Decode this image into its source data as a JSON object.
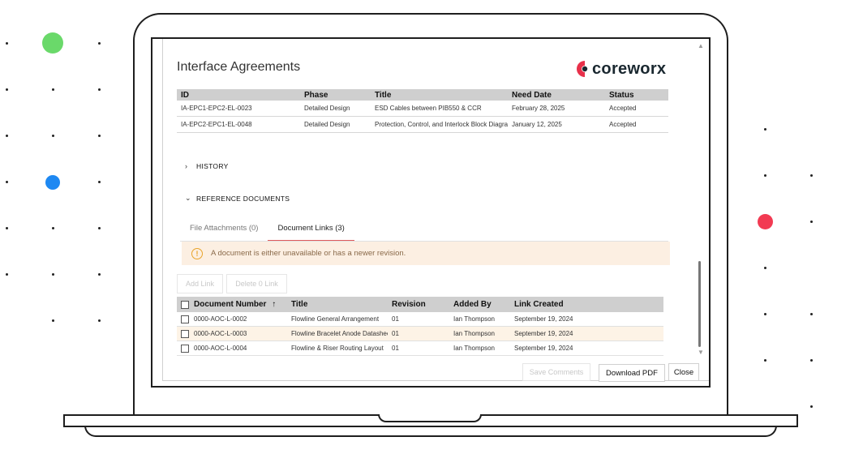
{
  "colors": {
    "dot_green": "#6ad96a",
    "dot_blue": "#1e88f2",
    "dot_red": "#f23a52",
    "logo_red": "#e8304a",
    "tab_accent": "#e05a5a",
    "warning_bg": "#fcefe2",
    "warning_icon": "#e8a32a"
  },
  "app": {
    "title": "Interface Agreements",
    "logo_text": "coreworx"
  },
  "agreements": {
    "columns": [
      "ID",
      "Phase",
      "Title",
      "Need Date",
      "Status"
    ],
    "rows": [
      [
        "IA-EPC1-EPC2-EL-0023",
        "Detailed Design",
        "ESD Cables between PIB550 & CCR",
        "February 28, 2025",
        "Accepted"
      ],
      [
        "IA-EPC2-EPC1-EL-0048",
        "Detailed Design",
        "Protection, Control, and Interlock Block Diagram",
        "January 12, 2025",
        "Accepted"
      ]
    ]
  },
  "sections": {
    "history": "HISTORY",
    "reference_documents": "REFERENCE DOCUMENTS"
  },
  "tabs": [
    {
      "label": "File Attachments (0)",
      "active": false
    },
    {
      "label": "Document Links (3)",
      "active": true
    }
  ],
  "warning": {
    "icon": "warning-circle-icon",
    "text": "A document is either unavailable or has a newer revision."
  },
  "actions": {
    "add_link": "Add Link",
    "delete_link": "Delete 0 Link",
    "save_comments": "Save Comments",
    "download_pdf": "Download PDF",
    "close": "Close"
  },
  "documents": {
    "columns": [
      "Document Number",
      "Title",
      "Revision",
      "Added By",
      "Link Created"
    ],
    "sort_icon": "arrow-up-icon",
    "rows": [
      [
        "0000-AOC-L-0002",
        "Flowline General Arrangement",
        "01",
        "Ian Thompson",
        "September 19, 2024"
      ],
      [
        "0000-AOC-L-0003",
        "Flowline Bracelet Anode Datasheet",
        "01",
        "Ian Thompson",
        "September 19, 2024"
      ],
      [
        "0000-AOC-L-0004",
        "Flowline & Riser Routing Layout",
        "01",
        "Ian Thompson",
        "September 19, 2024"
      ]
    ]
  }
}
